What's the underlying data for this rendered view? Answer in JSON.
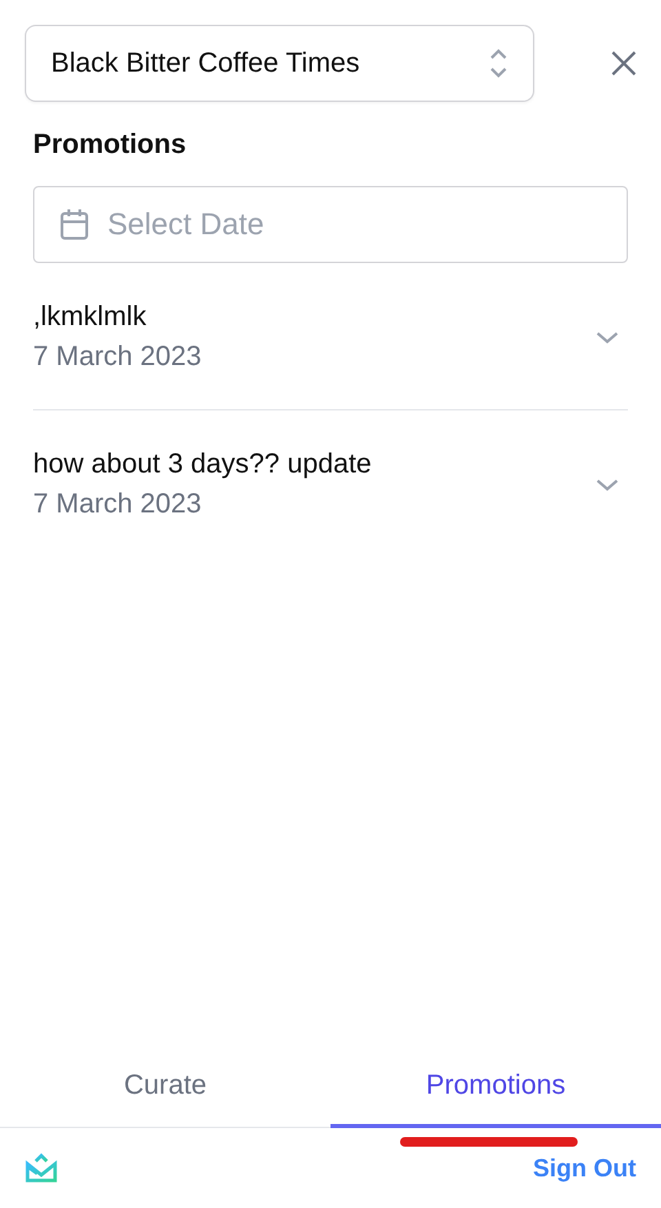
{
  "store_select": {
    "value": "Black Bitter Coffee Times"
  },
  "heading": "Promotions",
  "date_field": {
    "placeholder": "Select Date"
  },
  "promotions": [
    {
      "title": ",lkmklmlk",
      "date": "7 March 2023",
      "expanded": false
    },
    {
      "title": "how about 3 days?? update",
      "date": "7 March 2023",
      "expanded": false
    }
  ],
  "tabs": [
    {
      "label": "Curate",
      "selected": false
    },
    {
      "label": "Promotions",
      "selected": true
    }
  ],
  "footer": {
    "sign_out": "Sign Out"
  }
}
